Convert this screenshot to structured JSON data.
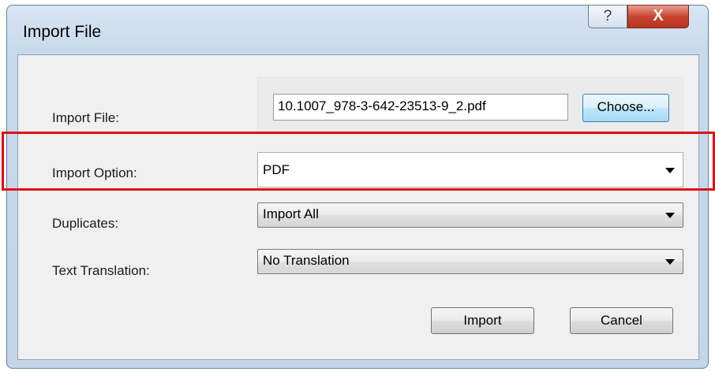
{
  "window": {
    "title": "Import File",
    "help_label": "?",
    "close_label": "X"
  },
  "import_file": {
    "label": "Import File:",
    "value": "10.1007_978-3-642-23513-9_2.pdf",
    "choose_label": "Choose..."
  },
  "import_option": {
    "label": "Import Option:",
    "selected": "PDF"
  },
  "duplicates": {
    "label": "Duplicates:",
    "selected": "Import All"
  },
  "text_translation": {
    "label": "Text Translation:",
    "selected": "No Translation"
  },
  "actions": {
    "import_label": "Import",
    "cancel_label": "Cancel"
  },
  "colors": {
    "highlight": "#e01010",
    "accent": "#3c7fb1"
  }
}
